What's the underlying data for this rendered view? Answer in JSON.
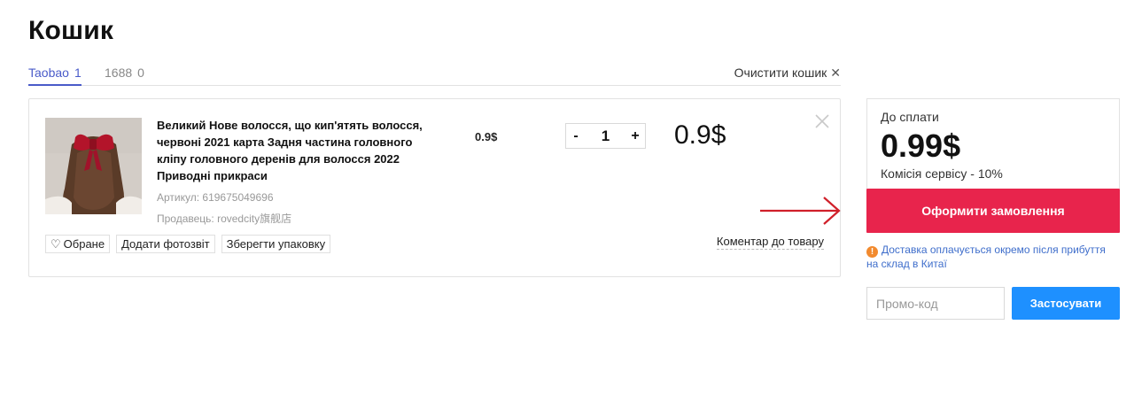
{
  "page": {
    "title": "Кошик"
  },
  "tabs": [
    {
      "label": "Taobao",
      "count": "1",
      "active": true
    },
    {
      "label": "1688",
      "count": "0",
      "active": false
    }
  ],
  "clear_cart": {
    "label": "Очистити кошик",
    "icon": "close-icon"
  },
  "item": {
    "title": "Великий Нове волосся, що кип'ятять волосся, червоні 2021 карта Задня частина головного кліпу головного деренів для волосся 2022 Приводні прикраси",
    "article": "Артикул: 619675049696",
    "seller": "Продавець: rovedcity旗舰店",
    "unit_price": "0.9$",
    "quantity": "1",
    "qty_minus": "-",
    "qty_plus": "+",
    "total": "0.9$",
    "remove_icon": "close-icon",
    "actions": {
      "favorite": "Обране",
      "favorite_icon": "heart-icon",
      "photo_report": "Додати фотозвіт",
      "save_packaging": "Зберегти упаковку"
    },
    "comment": "Коментар до товару"
  },
  "summary": {
    "label": "До сплати",
    "amount": "0.99$",
    "fee": "Комісія сервісу - 10%",
    "checkout": "Оформити замовлення",
    "checkout_color": "#e8244c"
  },
  "notice": {
    "icon": "warning-icon",
    "text": "Доставка оплачується окремо після прибуття на склад в Китаї"
  },
  "promo": {
    "placeholder": "Промо-код",
    "apply": "Застосувати",
    "apply_color": "#1e90ff"
  },
  "colors": {
    "accent": "#4a5bc9",
    "arrow": "#d0202a",
    "notice": "#3f6ecb",
    "warning": "#f28a2e"
  }
}
